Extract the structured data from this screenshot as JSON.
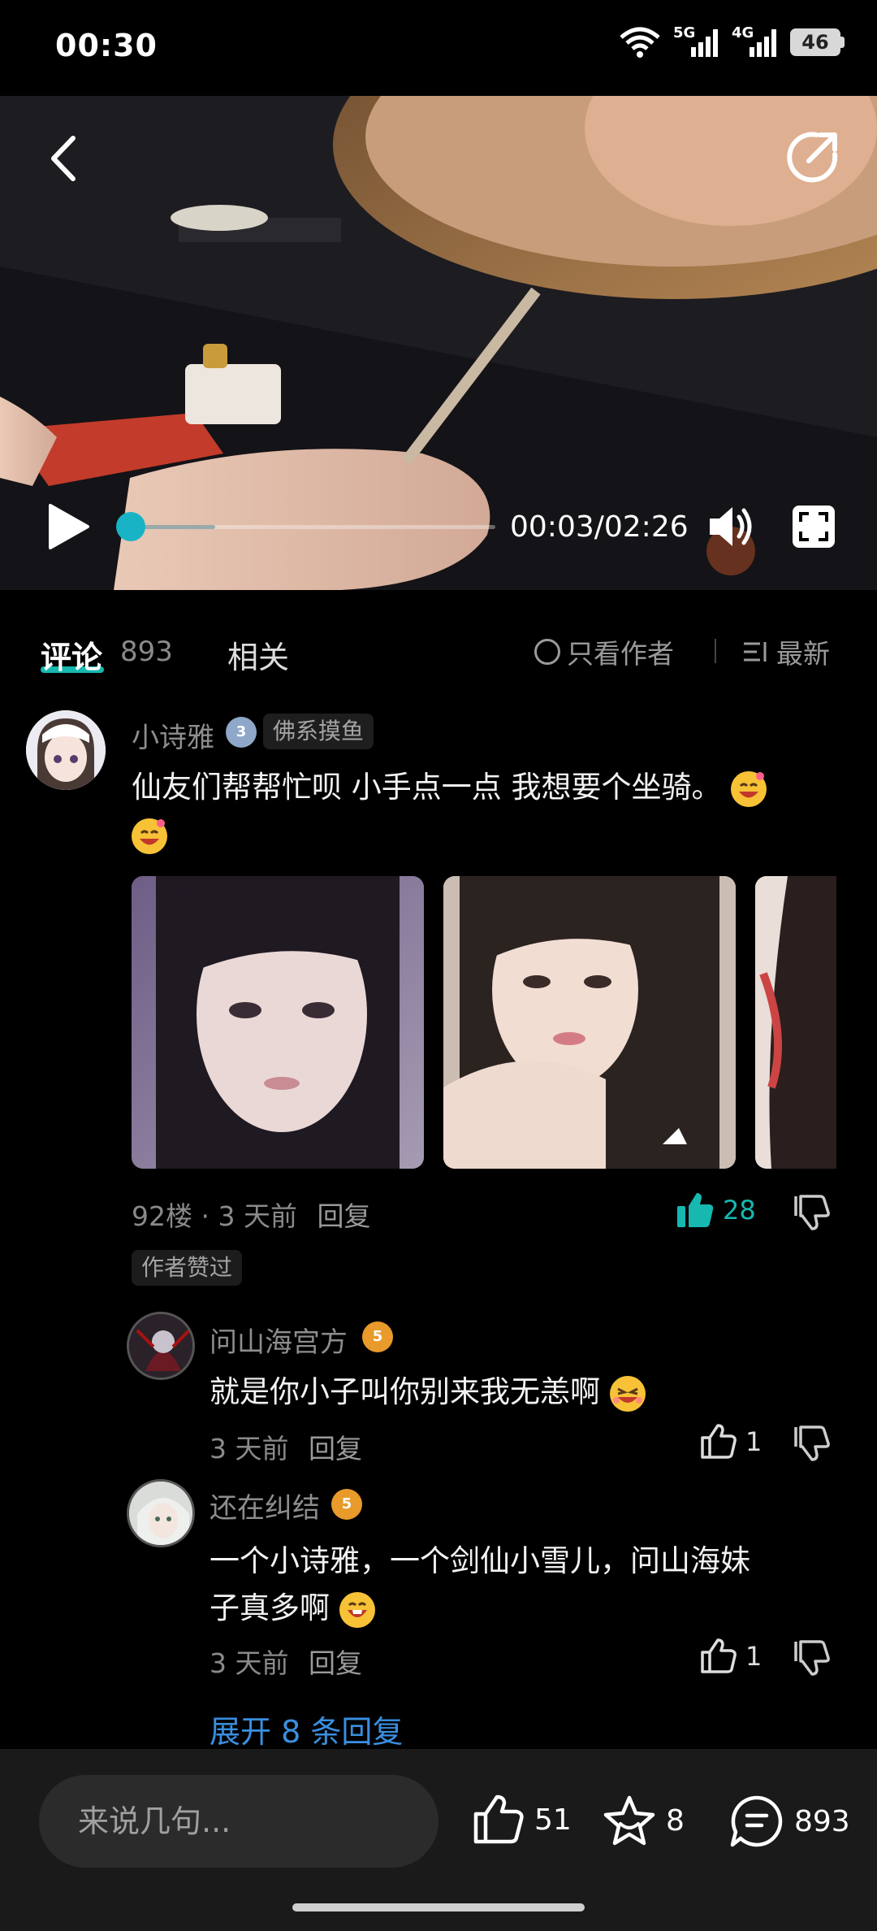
{
  "status_bar": {
    "time": "00:30",
    "signal_1_label": "5G",
    "signal_2_label": "4G",
    "battery": "46"
  },
  "video": {
    "current_time": "00:03",
    "duration": "02:26",
    "time_display": "00:03/02:26",
    "progress_fraction": 0.023,
    "buffered_fraction": 0.25
  },
  "tabs": {
    "comments_label": "评论",
    "comments_count": "893",
    "related_label": "相关",
    "author_only_label": "只看作者",
    "sort_label": "最新"
  },
  "comment": {
    "username": "小诗雅",
    "level": "3",
    "tag": "佛系摸鱼",
    "text_line1": "仙友们帮帮忙呗 小手点一点 我想要个坐骑。",
    "floor": "92楼",
    "time": "3 天前",
    "reply_label": "回复",
    "likes": "28",
    "author_liked": "作者赞过",
    "accent_color": "#16b8b0"
  },
  "replies": [
    {
      "username": "问山海宫方",
      "level": "5",
      "text": "就是你小子叫你别来我无恙啊",
      "time": "3 天前",
      "reply_label": "回复",
      "likes": "1"
    },
    {
      "username": "还在纠结",
      "level": "5",
      "text_line1": "一个小诗雅，一个剑仙小雪儿，问山海妹",
      "text_line2": "子真多啊",
      "time": "3 天前",
      "reply_label": "回复",
      "likes": "1"
    }
  ],
  "expand_replies": "展开 8 条回复",
  "bottom_bar": {
    "input_placeholder": "来说几句...",
    "likes": "51",
    "favorites": "8",
    "comments": "893"
  }
}
